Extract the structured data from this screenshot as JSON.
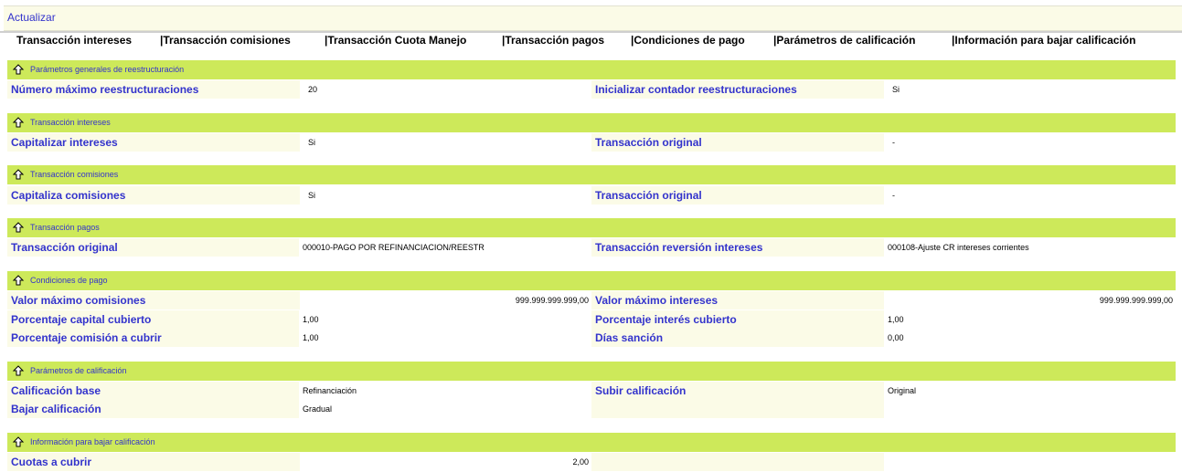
{
  "toolbar": {
    "update_label": "Actualizar"
  },
  "tabs": [
    "Transacción intereses",
    "|Transacción comisiones",
    "|Transacción Cuota Manejo",
    "|Transacción pagos",
    "|Condiciones de pago",
    "|Parámetros de calificación",
    "|Información para bajar calificación"
  ],
  "sections": {
    "restructuring": {
      "title": "Parámetros generales de reestructuración",
      "max_restructurings_label": "Número máximo reestructuraciones",
      "max_restructurings_value": "20",
      "init_counter_label": "Inicializar contador reestructuraciones",
      "init_counter_value": "Si"
    },
    "interest_tx": {
      "title": "Transacción intereses",
      "capitalize_label": "Capitalizar intereses",
      "capitalize_value": "Si",
      "original_tx_label": "Transacción original",
      "original_tx_value": "-"
    },
    "commission_tx": {
      "title": "Transacción comisiones",
      "capitalize_label": "Capitaliza comisiones",
      "capitalize_value": "Si",
      "original_tx_label": "Transacción original",
      "original_tx_value": "-"
    },
    "payment_tx": {
      "title": "Transacción pagos",
      "original_tx_label": "Transacción original",
      "original_tx_value": "000010-PAGO POR REFINANCIACION/REESTR",
      "reversal_label": "Transacción reversión intereses",
      "reversal_value": "000108-Ajuste CR intereses corrientes"
    },
    "payment_conditions": {
      "title": "Condiciones de pago",
      "max_commissions_label": "Valor máximo comisiones",
      "max_commissions_value": "999.999.999.999,00",
      "max_interest_label": "Valor máximo intereses",
      "max_interest_value": "999.999.999.999,00",
      "capital_pct_label": "Porcentaje capital cubierto",
      "capital_pct_value": "1,00",
      "interest_pct_label": "Porcentaje interés cubierto",
      "interest_pct_value": "1,00",
      "commission_pct_label": "Porcentaje comisión a cubrir",
      "commission_pct_value": "1,00",
      "penalty_days_label": "Días sanción",
      "penalty_days_value": "0,00"
    },
    "rating_params": {
      "title": "Parámetros de calificación",
      "base_label": "Calificación base",
      "base_value": "Refinanciación",
      "raise_label": "Subir calificación",
      "raise_value": "Original",
      "lower_label": "Bajar calificación",
      "lower_value": "Gradual"
    },
    "lower_rating_info": {
      "title": "Información para bajar calificación",
      "installments_label": "Cuotas a cubrir",
      "installments_value": "2,00"
    }
  },
  "colors": {
    "section_bg": "#cde95a",
    "label_bg": "#fbfbe7",
    "label_text": "#3333cc"
  },
  "icons": {
    "section_toggle": "arrow-up-icon"
  }
}
